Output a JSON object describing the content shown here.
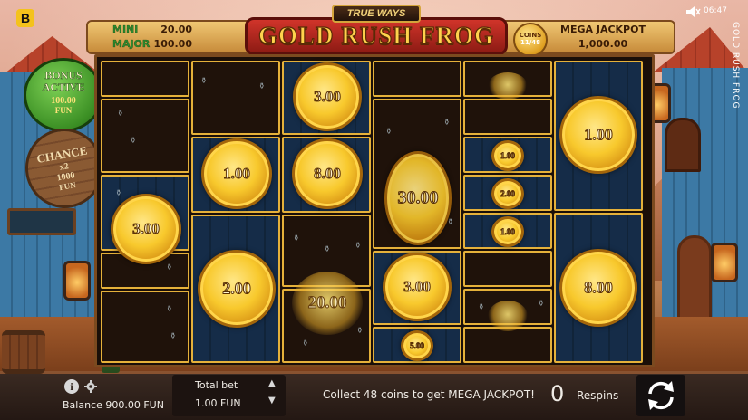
{
  "brand": {
    "logo_letter": "B"
  },
  "status": {
    "clock": "06:47",
    "side_title": "GOLD RUSH FROG"
  },
  "header": {
    "trueways": "TRUE WAYS",
    "title": "GOLD RUSH FROG",
    "mini": {
      "label": "MINI",
      "value": "20.00"
    },
    "major": {
      "label": "MAJOR",
      "value": "100.00"
    },
    "coins": {
      "label": "COINS",
      "count": "11/48"
    },
    "mega": {
      "label": "MEGA JACKPOT",
      "value": "1,000.00"
    }
  },
  "bonus": {
    "title": "BONUS ACTIVE",
    "value": "100.00",
    "unit": "FUN"
  },
  "chance": {
    "title": "CHANCE",
    "multiplier": "x2",
    "value": "1000",
    "unit": "FUN"
  },
  "reels": {
    "coins": [
      "3.00",
      "1.00",
      "8.00",
      "30.00",
      "1.00",
      "1.00",
      "2.00",
      "3.00",
      "1.00",
      "2.00",
      "3.00",
      "8.00",
      "5.00"
    ],
    "ghost_coins": [
      "20.00"
    ]
  },
  "footer": {
    "balance": "Balance 900.00 FUN",
    "total_bet_label": "Total bet",
    "total_bet_value": "1.00 FUN",
    "message": "Collect 48 coins to get MEGA JACKPOT!",
    "respins_count": "0",
    "respins_label": "Respins"
  },
  "icons": [
    "info-icon",
    "gear-icon",
    "sound-icon",
    "spin-arrows-icon",
    "arrow-up-icon",
    "arrow-down-icon"
  ],
  "colors": {
    "cell_border": "#e5b13a",
    "coin_gold": "#f8c92d",
    "bonus_green": "#3b8f24",
    "title_red": "#c2271f"
  }
}
